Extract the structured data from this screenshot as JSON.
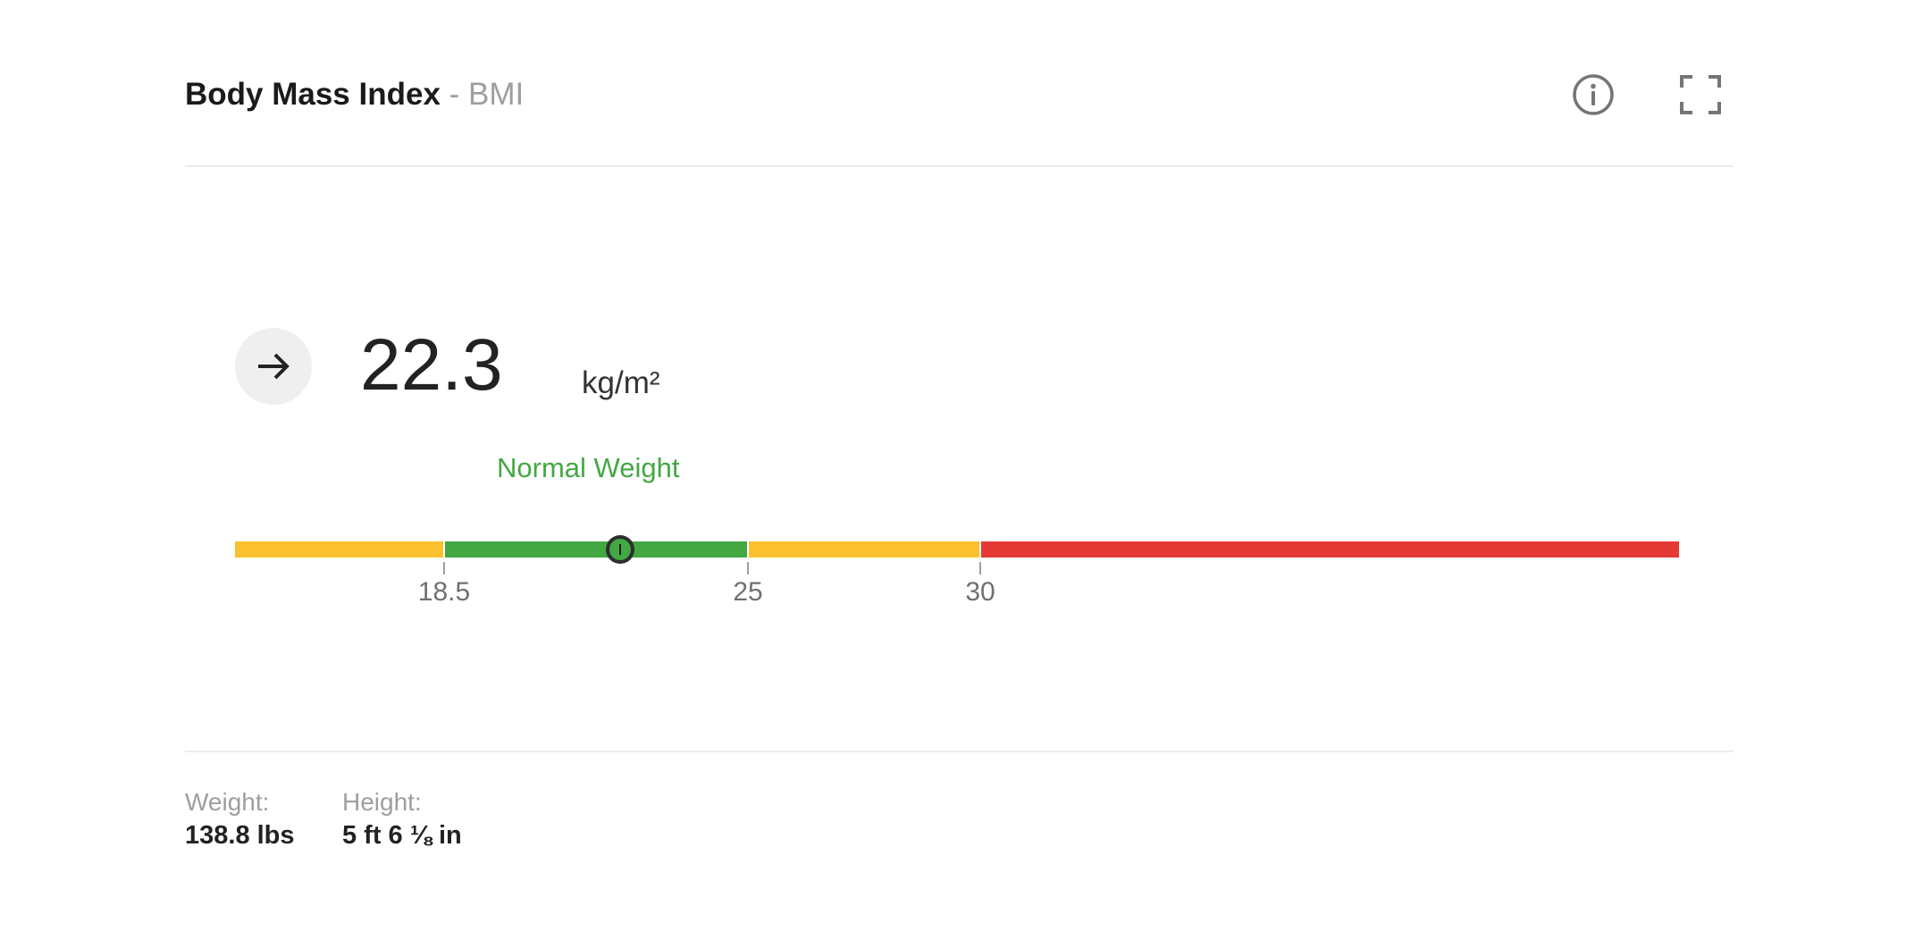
{
  "header": {
    "title": "Body Mass Index",
    "subtitle": "- BMI",
    "info_icon": "info-icon",
    "fullscreen_icon": "fullscreen-icon"
  },
  "reading": {
    "trend_icon": "arrow-right-icon",
    "value": "22.3",
    "unit": "kg/m²",
    "category": "Normal Weight"
  },
  "scale": {
    "segments": [
      {
        "from": 0,
        "to": 18.5,
        "color": "#fbc02d"
      },
      {
        "from": 18.5,
        "to": 25,
        "color": "#43a843"
      },
      {
        "from": 25,
        "to": 30,
        "color": "#fbc02d"
      },
      {
        "from": 30,
        "to": 40,
        "color": "#e53935"
      }
    ],
    "ticks": [
      "18.5",
      "25",
      "30"
    ],
    "marker_value": 22.3
  },
  "stats": {
    "weight_label": "Weight:",
    "weight_value": "138.8 lbs",
    "height_label": "Height:",
    "height_value": "5 ft 6 ⅛ in"
  },
  "colors": {
    "normal": "#43a843",
    "warning": "#fbc02d",
    "danger": "#e53935"
  }
}
